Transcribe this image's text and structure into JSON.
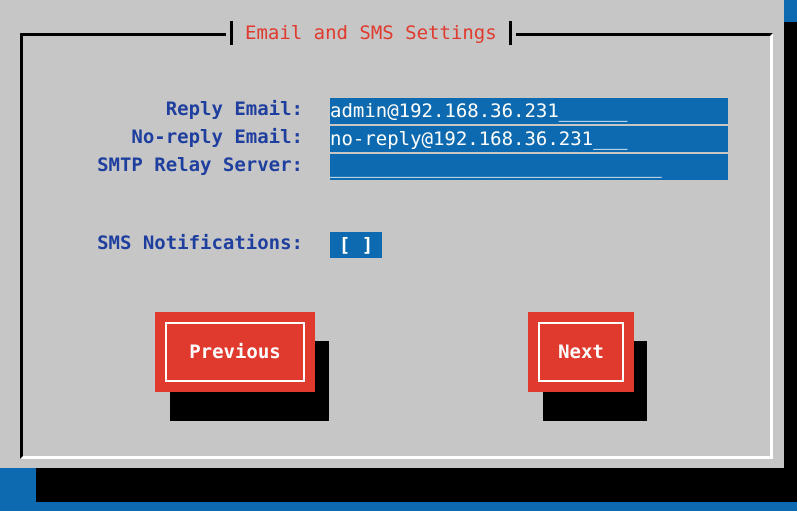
{
  "dialog": {
    "title": "Email and SMS Settings"
  },
  "fields": {
    "reply_email": {
      "label": "Reply Email:",
      "value": "admin@192.168.36.231",
      "fill": "______"
    },
    "noreply_email": {
      "label": "No-reply Email:",
      "value": "no-reply@192.168.36.231",
      "fill": "___"
    },
    "smtp_relay": {
      "label": "SMTP Relay Server:",
      "value": "",
      "fill": "_____________________________"
    },
    "sms_notifications": {
      "label": "SMS Notifications:",
      "value": "[ ]"
    }
  },
  "buttons": {
    "previous": "Previous",
    "next": "Next"
  },
  "colors": {
    "background": "#0e6ab0",
    "dialog": "#c6c6c6",
    "accent": "#e0392d",
    "label": "#1f3f9f"
  }
}
